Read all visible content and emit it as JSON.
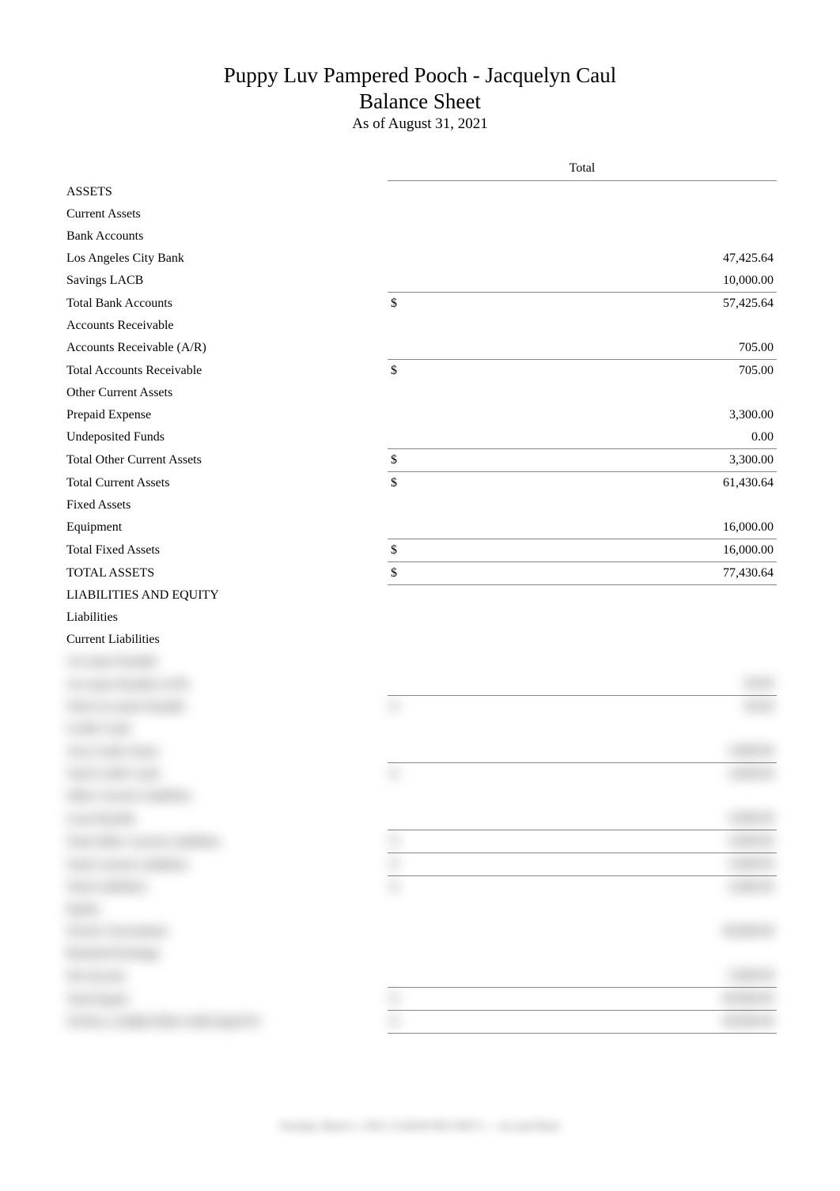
{
  "header": {
    "company": "Puppy Luv Pampered Pooch - Jacquelyn Caul",
    "title": "Balance Sheet",
    "subtitle": "As of August 31, 2021"
  },
  "column_header": "Total",
  "rows": [
    {
      "label": "ASSETS",
      "indent": 0
    },
    {
      "label": "Current Assets",
      "indent": 1
    },
    {
      "label": "Bank Accounts",
      "indent": 2
    },
    {
      "label": "Los Angeles City Bank",
      "indent": 3,
      "value": "47,425.64"
    },
    {
      "label": "Savings LACB",
      "indent": 3,
      "value": "10,000.00"
    },
    {
      "label": "Total Bank Accounts",
      "indent": 2,
      "currency": "$",
      "value": "57,425.64",
      "rule": "top"
    },
    {
      "label": "Accounts Receivable",
      "indent": 2
    },
    {
      "label": "Accounts Receivable (A/R)",
      "indent": 3,
      "value": "705.00"
    },
    {
      "label": "Total Accounts Receivable",
      "indent": 2,
      "currency": "$",
      "value": "705.00",
      "rule": "top"
    },
    {
      "label": "Other Current Assets",
      "indent": 2
    },
    {
      "label": "Prepaid Expense",
      "indent": 3,
      "value": "3,300.00"
    },
    {
      "label": "Undeposited Funds",
      "indent": 3,
      "value": "0.00"
    },
    {
      "label": "Total Other Current Assets",
      "indent": 2,
      "currency": "$",
      "value": "3,300.00",
      "rule": "top"
    },
    {
      "label": "Total Current Assets",
      "indent": 1,
      "currency": "$",
      "value": "61,430.64",
      "rule": "top"
    },
    {
      "label": "Fixed Assets",
      "indent": 1
    },
    {
      "label": "Equipment",
      "indent": 2,
      "value": "16,000.00"
    },
    {
      "label": "Total Fixed Assets",
      "indent": 1,
      "currency": "$",
      "value": "16,000.00",
      "rule": "top"
    },
    {
      "label": "TOTAL ASSETS",
      "indent": 0,
      "currency": "$",
      "value": "77,430.64",
      "rule": "topdbl"
    },
    {
      "label": "LIABILITIES AND EQUITY",
      "indent": 0
    },
    {
      "label": "Liabilities",
      "indent": 1
    },
    {
      "label": "Current Liabilities",
      "indent": 2
    }
  ],
  "blurred_rows": [
    {
      "label": "Accounts Payable",
      "indent": 3
    },
    {
      "label": "Accounts Payable (A/P)",
      "indent": 4,
      "value": "00.00"
    },
    {
      "label": "Total Accounts Payable",
      "indent": 3,
      "currency": "$",
      "value": "00.00",
      "rule": "top"
    },
    {
      "label": "Credit Cards",
      "indent": 3
    },
    {
      "label": "Visa Credit Union",
      "indent": 4,
      "value": "0,000.00"
    },
    {
      "label": "Total Credit Cards",
      "indent": 3,
      "currency": "$",
      "value": "0,000.00",
      "rule": "top"
    },
    {
      "label": "Other Current Liabilities",
      "indent": 3
    },
    {
      "label": "Loan Payable",
      "indent": 4,
      "value": "0,000.00"
    },
    {
      "label": "Total Other Current Liabilities",
      "indent": 3,
      "currency": "$",
      "value": "0,000.00",
      "rule": "top"
    },
    {
      "label": "Total Current Liabilities",
      "indent": 2,
      "currency": "$",
      "value": "0,000.00",
      "rule": "top"
    },
    {
      "label": "Total Liabilities",
      "indent": 1,
      "currency": "$",
      "value": "0,000.00",
      "rule": "top"
    },
    {
      "label": "Equity",
      "indent": 1
    },
    {
      "label": "Owner's Investment",
      "indent": 2,
      "value": "00,000.00"
    },
    {
      "label": "Retained Earnings",
      "indent": 2
    },
    {
      "label": "Net Income",
      "indent": 2,
      "value": "0,000.00"
    },
    {
      "label": "Total Equity",
      "indent": 1,
      "currency": "$",
      "value": "00,000.00",
      "rule": "top"
    },
    {
      "label": "TOTAL LIABILITIES AND EQUITY",
      "indent": 0,
      "currency": "$",
      "value": "00,000.00",
      "rule": "topdbl"
    }
  ],
  "footer": "Tuesday, March 1, 2022 12:00:00 PM GMT-5 — Accrual Basis"
}
